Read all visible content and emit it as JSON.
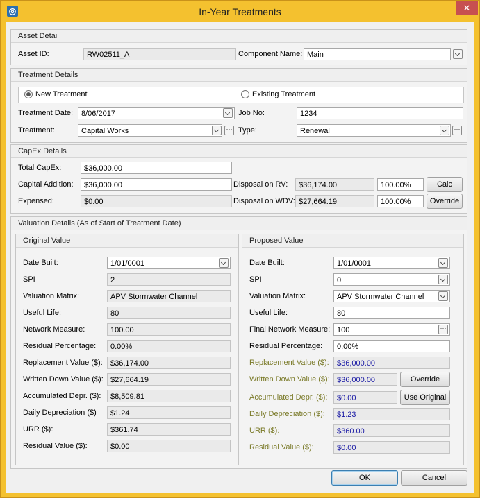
{
  "window": {
    "title": "In-Year Treatments",
    "close_symbol": "✕",
    "app_icon_symbol": "◎"
  },
  "asset_detail": {
    "title": "Asset Detail",
    "asset_id_label": "Asset ID:",
    "asset_id": "RW02511_A",
    "component_name_label": "Component Name:",
    "component_name": "Main"
  },
  "treatment_details": {
    "title": "Treatment Details",
    "new_treatment": "New Treatment",
    "existing_treatment": "Existing Treatment",
    "treatment_date_label": "Treatment Date:",
    "treatment_date": "8/06/2017",
    "job_no_label": "Job No:",
    "job_no": "1234",
    "treatment_label": "Treatment:",
    "treatment": "Capital Works",
    "type_label": "Type:",
    "type": "Renewal",
    "ellipsis": "···"
  },
  "capex": {
    "title": "CapEx Details",
    "total_label": "Total CapEx:",
    "total": "$36,000.00",
    "capital_addition_label": "Capital Addition:",
    "capital_addition": "$36,000.00",
    "expensed_label": "Expensed:",
    "expensed": "$0.00",
    "disposal_rv_label": "Disposal on RV:",
    "disposal_rv": "$36,174.00",
    "disposal_rv_pct": "100.00%",
    "disposal_wdv_label": "Disposal on WDV:",
    "disposal_wdv": "$27,664.19",
    "disposal_wdv_pct": "100.00%",
    "calc_button": "Calc",
    "override_button": "Override"
  },
  "valuation": {
    "title": "Valuation Details (As of Start of Treatment Date)",
    "original": {
      "title": "Original Value",
      "date_built_label": "Date Built:",
      "date_built": "1/01/0001",
      "spi_label": "SPI",
      "spi": "2",
      "matrix_label": "Valuation Matrix:",
      "matrix": "APV Stormwater Channel",
      "useful_life_label": "Useful Life:",
      "useful_life": "80",
      "network_measure_label": "Network Measure:",
      "network_measure": "100.00",
      "residual_pct_label": "Residual Percentage:",
      "residual_pct": "0.00%",
      "replacement_label": "Replacement Value ($):",
      "replacement": "$36,174.00",
      "wdv_label": "Written Down Value ($):",
      "wdv": "$27,664.19",
      "accum_label": "Accumulated Depr. ($):",
      "accum": "$8,509.81",
      "daily_label": "Daily Depreciation ($)",
      "daily": "$1.24",
      "urr_label": "URR ($):",
      "urr": "$361.74",
      "residual_value_label": "Residual Value ($):",
      "residual_value": "$0.00"
    },
    "proposed": {
      "title": "Proposed Value",
      "date_built_label": "Date Built:",
      "date_built": "1/01/0001",
      "spi_label": "SPI",
      "spi": "0",
      "matrix_label": "Valuation Matrix:",
      "matrix": "APV Stormwater Channel",
      "useful_life_label": "Useful Life:",
      "useful_life": "80",
      "final_network_label": "Final Network Measure:",
      "final_network": "100",
      "residual_pct_label": "Residual Percentage:",
      "residual_pct": "0.00%",
      "replacement_label": "Replacement Value ($):",
      "replacement": "$36,000.00",
      "wdv_label": "Written Down Value ($):",
      "wdv": "$36,000.00",
      "accum_label": "Accumulated Depr. ($):",
      "accum": "$0.00",
      "daily_label": "Daily Depreciation  ($):",
      "daily": "$1.23",
      "urr_label": "URR ($):",
      "urr": "$360.00",
      "residual_value_label": "Residual Value ($):",
      "residual_value": "$0.00",
      "override_button": "Override",
      "use_original_button": "Use Original"
    }
  },
  "footer": {
    "ok": "OK",
    "cancel": "Cancel"
  }
}
